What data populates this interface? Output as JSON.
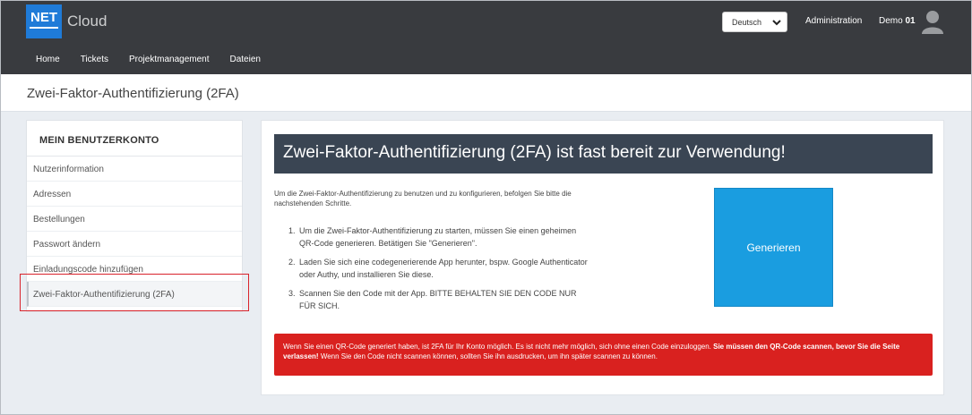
{
  "brand": {
    "logo_box": "NET",
    "logo_text": "Cloud"
  },
  "header": {
    "language": "Deutsch",
    "admin_label": "Administration",
    "user_name": "Demo",
    "user_number": "01"
  },
  "nav": {
    "items": [
      {
        "label": "Home"
      },
      {
        "label": "Tickets"
      },
      {
        "label": "Projektmanagement"
      },
      {
        "label": "Dateien"
      }
    ]
  },
  "page": {
    "title": "Zwei-Faktor-Authentifizierung (2FA)"
  },
  "sidebar": {
    "heading": "MEIN BENUTZERKONTO",
    "items": [
      {
        "label": "Nutzerinformation"
      },
      {
        "label": "Adressen"
      },
      {
        "label": "Bestellungen"
      },
      {
        "label": "Passwort ändern"
      },
      {
        "label": "Einladungscode hinzufügen"
      },
      {
        "label": "Zwei-Faktor-Authentifizierung (2FA)"
      }
    ]
  },
  "main": {
    "heading": "Zwei-Faktor-Authentifizierung (2FA) ist fast bereit zur Verwendung!",
    "intro": "Um die Zwei-Faktor-Authentifizierung zu benutzen und zu konfigurieren, befolgen Sie bitte die nachstehenden Schritte.",
    "steps": [
      {
        "num": "1.",
        "text": "Um die Zwei-Faktor-Authentifizierung zu starten, müssen Sie einen geheimen QR-Code generieren. Betätigen Sie \"Generieren\"."
      },
      {
        "num": "2.",
        "text": "Laden Sie sich eine codegenerierende App herunter, bspw. Google Authenticator oder Authy, und installieren Sie diese."
      },
      {
        "num": "3.",
        "text": "Scannen Sie den Code mit der App. BITTE BEHALTEN SIE DEN CODE NUR FÜR SICH."
      }
    ],
    "generate_label": "Generieren",
    "warning": {
      "part1": "Wenn Sie einen QR-Code generiert haben, ist 2FA für Ihr Konto möglich. Es ist nicht mehr möglich, sich ohne einen Code einzuloggen. ",
      "bold": "Sie müssen den QR-Code scannen, bevor Sie die Seite verlassen!",
      "part2": " Wenn Sie den Code nicht scannen können, sollten Sie ihn ausdrucken, um ihn später scannen zu können."
    }
  },
  "colors": {
    "topbar": "#393b3f",
    "accent": "#1a9de0",
    "warning": "#d9211f",
    "highlight": "#d9232b"
  }
}
